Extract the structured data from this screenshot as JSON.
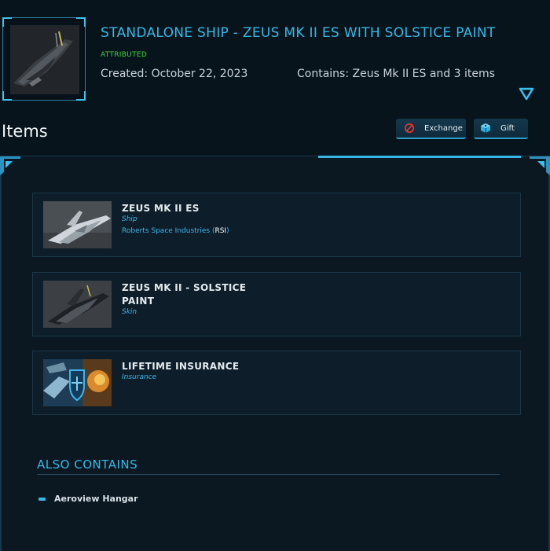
{
  "pledge": {
    "title": "STANDALONE SHIP - ZEUS MK II ES WITH SOLSTICE PAINT",
    "status": "ATTRIBUTED",
    "created": "Created: October 22, 2023",
    "contains": "Contains: Zeus Mk II ES and 3 items",
    "thumbnail_icon": "zeus-ship-solstice-image",
    "expand_icon": "triangle-down-icon"
  },
  "items_section": {
    "heading": "Items",
    "actions": [
      {
        "label": "Exchange",
        "icon": "prohibited-icon"
      },
      {
        "label": "Gift",
        "icon": "gift-cube-icon"
      }
    ],
    "items": [
      {
        "name": "ZEUS MK II ES",
        "type": "Ship",
        "manufacturer": "Roberts Space Industries (",
        "manufacturer_code": "RSI",
        "manufacturer_close": ")",
        "image": "zeus-ship-image"
      },
      {
        "name": "ZEUS MK II - SOLSTICE PAINT",
        "type": "Skin",
        "image": "solstice-paint-image"
      },
      {
        "name": "LIFETIME INSURANCE",
        "type": "Insurance",
        "image": "insurance-shield-image"
      }
    ]
  },
  "also_contains": {
    "heading": "ALSO CONTAINS",
    "items": [
      {
        "label": "Aeroview Hangar"
      }
    ]
  },
  "colors": {
    "background": "#08141c",
    "accent": "#34b8e6",
    "status_green": "#3bd63b",
    "panel": "#0b1822",
    "card": "#0d1e2a"
  }
}
